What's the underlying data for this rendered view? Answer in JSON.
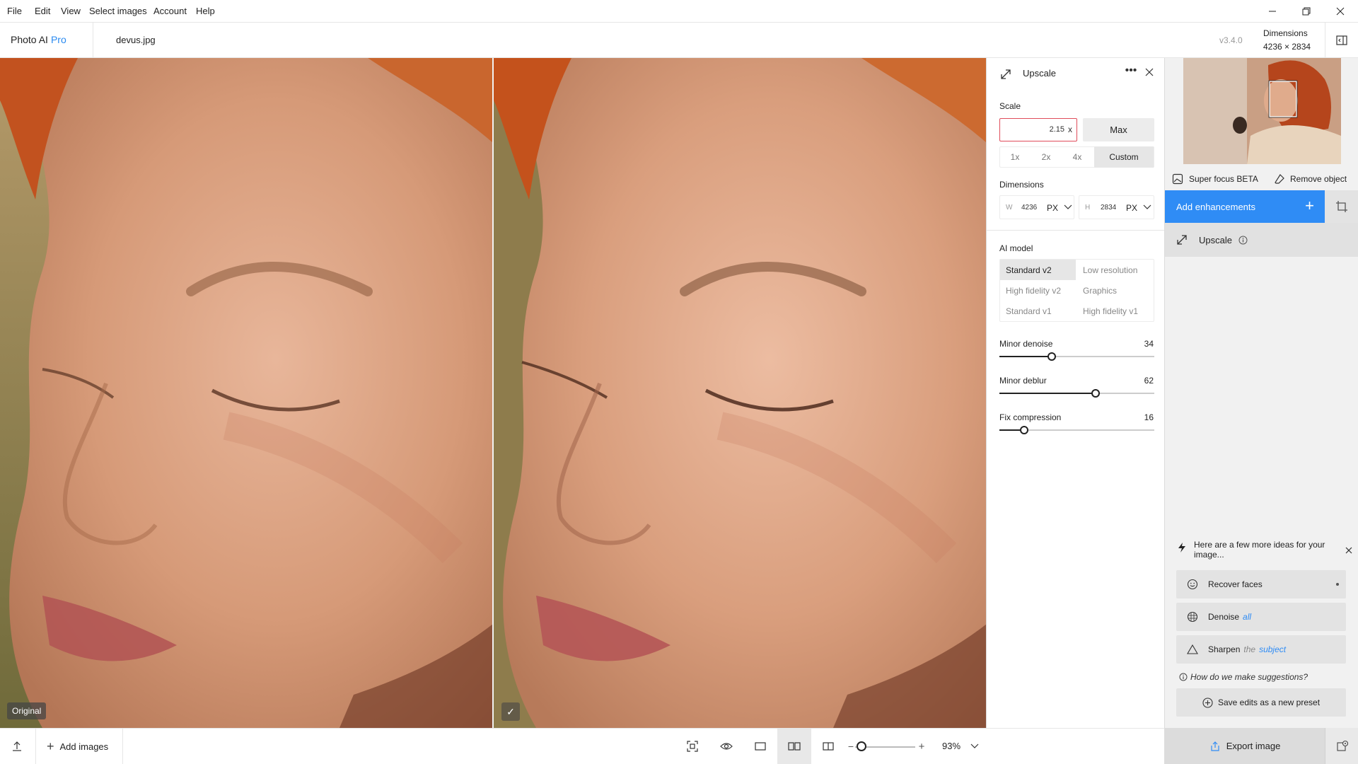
{
  "menubar": {
    "items": [
      "File",
      "Edit",
      "View",
      "Select images",
      "Account",
      "Help"
    ]
  },
  "header": {
    "brand": "Photo AI",
    "brand_tier": "Pro",
    "filename": "devus.jpg",
    "version": "v3.4.0",
    "dimensions_label": "Dimensions",
    "dimensions_value": "4236 × 2834"
  },
  "viewer": {
    "left_badge": "Original",
    "right_badge": "✓"
  },
  "bottombar": {
    "add_images_label": "Add images",
    "zoom_percent": "93%",
    "zoom_level": 0.1
  },
  "upscale_panel": {
    "title": "Upscale",
    "scale_label": "Scale",
    "scale_value": "2.15",
    "scale_suffix": "x",
    "max_label": "Max",
    "presets": [
      "1x",
      "2x",
      "4x",
      "Custom"
    ],
    "selected_preset": "Custom",
    "dimensions_label": "Dimensions",
    "width_letter": "W",
    "width_value": "4236",
    "width_unit": "PX",
    "height_letter": "H",
    "height_value": "2834",
    "height_unit": "PX",
    "ai_model_label": "AI model",
    "models": [
      "Standard v2",
      "Low resolution",
      "High fidelity v2",
      "Graphics",
      "Standard v1",
      "High fidelity v1"
    ],
    "selected_model": "Standard v2",
    "sliders": [
      {
        "label": "Minor denoise",
        "value": 34
      },
      {
        "label": "Minor deblur",
        "value": 62
      },
      {
        "label": "Fix compression",
        "value": 16
      }
    ]
  },
  "right_panel": {
    "super_focus_label": "Super focus BETA",
    "remove_object_label": "Remove object",
    "add_enhancements_label": "Add enhancements",
    "upscale_item_label": "Upscale",
    "ideas_text": "Here are a few more ideas for your image...",
    "suggestions": [
      {
        "label": "Recover faces",
        "suffix": "",
        "suffix2": ""
      },
      {
        "label": "Denoise",
        "suffix": "all",
        "suffix2": ""
      },
      {
        "label": "Sharpen",
        "suffix": "the",
        "suffix2": "subject"
      }
    ],
    "how_link": "How do we make suggestions?",
    "save_preset_label": "Save edits as a new preset",
    "export_label": "Export image"
  },
  "colors": {
    "accent": "#2f8cf5",
    "invalid_border": "#e04c5a"
  }
}
